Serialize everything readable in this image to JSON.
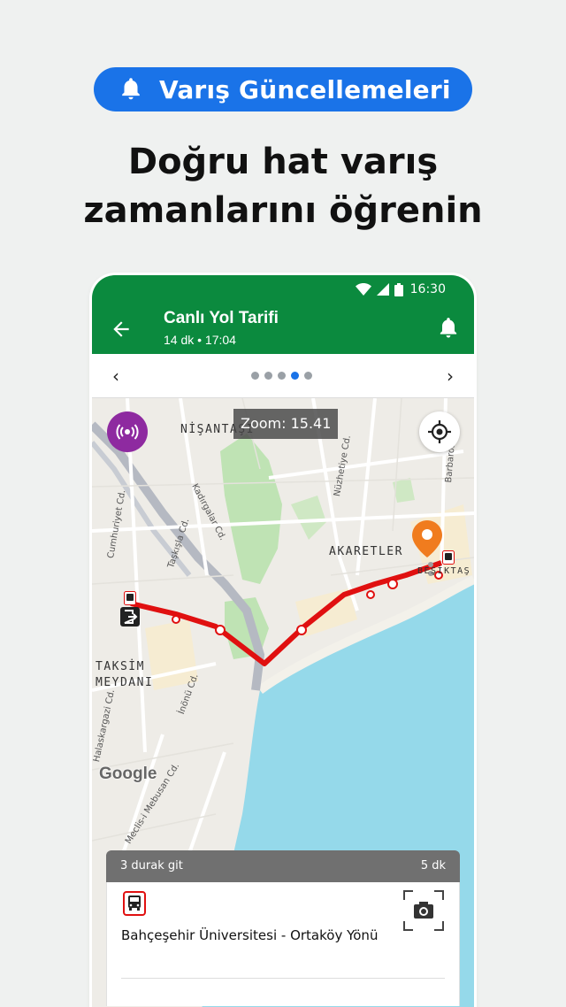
{
  "banner": {
    "label": "Varış Güncellemeleri",
    "icon": "bell-icon",
    "color": "#1a73e8"
  },
  "headline": {
    "line1": "Doğru hat varış",
    "line2": "zamanlarını öğrenin"
  },
  "status": {
    "time": "16:30"
  },
  "appbar": {
    "title": "Canlı Yol Tarifi",
    "subtitle": "14 dk • 17:04",
    "color": "#0b8a3e"
  },
  "pager": {
    "prev": "‹",
    "next": "›",
    "pages": 5,
    "active": 4
  },
  "map": {
    "zoom_text": "Zoom: 15.41",
    "labels": {
      "nisantasi": "NİŞANTAŞI",
      "akaretler": "AKARETLER",
      "besiktas": "BEŞİKTAŞ",
      "taksim": "TAKSİM",
      "meydani": "MEYDANI"
    },
    "streets": {
      "cumhuriyet": "Cumhuriyet Cd.",
      "taskisla": "Taşkışla Cd.",
      "kadirgalar": "Kadırgalar Cd.",
      "nuzhetiye": "Nüzhetiye Cd.",
      "barbaros": "Barbaros B.",
      "inonu": "İnönü Cd.",
      "elmadag": "Halaskargazi Cd.",
      "meclis": "Meclis-i Mebusan Cd."
    },
    "attribution": "Google",
    "route_color": "#e01010"
  },
  "sheet": {
    "header_left": "3 durak git",
    "header_right": "5 dk",
    "stop_name": "Bahçeşehir Üniversitesi - Ortaköy Yönü"
  }
}
